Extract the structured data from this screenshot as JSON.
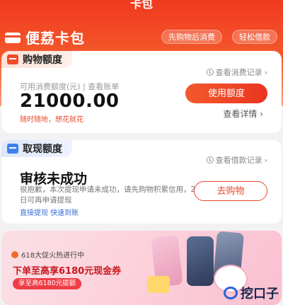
{
  "header": {
    "title": "卡包",
    "brand_name": "便荔卡包",
    "pills": [
      "先购物后消费",
      "轻松借款"
    ]
  },
  "shopping_card": {
    "tag": "购物额度",
    "history_link": "查看消费记录",
    "credit_caption": "可用消费额度(元) | 查看账单",
    "amount": "21000.00",
    "slogan": "随时随地，想花就花",
    "use_button": "使用额度",
    "details_link": "查看详情"
  },
  "cash_card": {
    "tag": "取现额度",
    "history_link": "查看借款记录",
    "status_title": "审核未成功",
    "status_desc": "很抱歉，本次提现申请未成功，请先购物积累信用，25日可再申请提现",
    "links": "直接提现  快速到账",
    "shop_button": "去购物"
  },
  "promo_banner": {
    "badge": "618大促火热进行中",
    "headline": "下单至高享6180元现金券",
    "sub": "享至高6180元提额"
  },
  "watermark_text": "挖口子",
  "colors": {
    "primary": "#ea3420",
    "link_blue": "#3a6fd8"
  }
}
